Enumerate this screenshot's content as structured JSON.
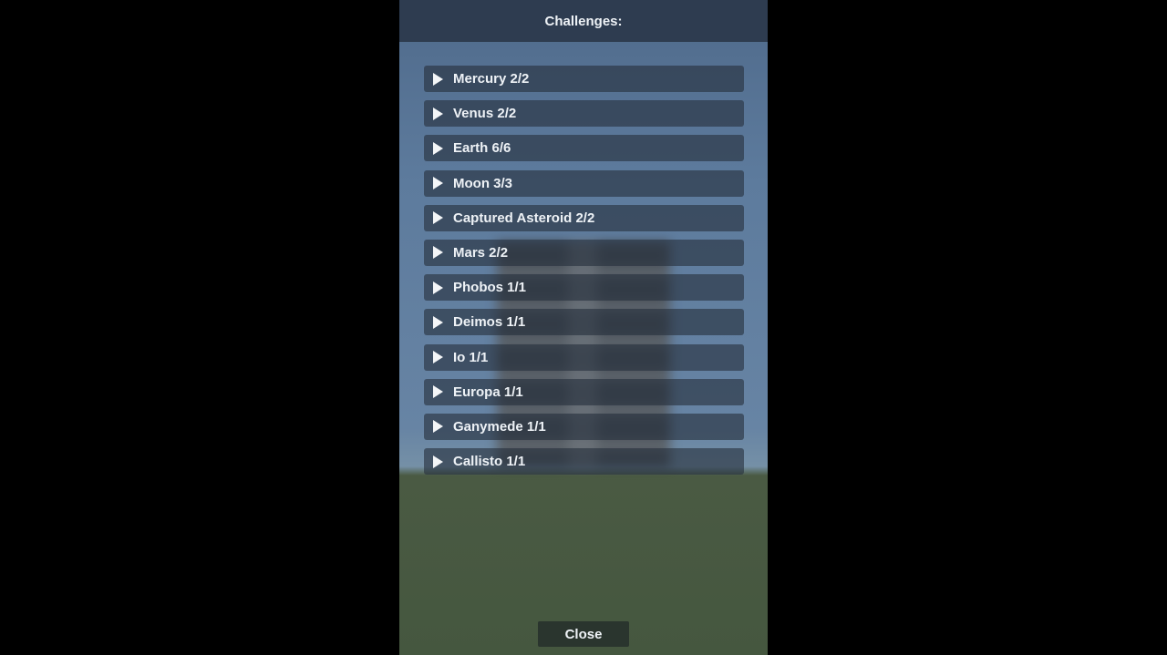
{
  "header": {
    "title": "Challenges:"
  },
  "challenges": [
    {
      "label": "Mercury 2/2"
    },
    {
      "label": "Venus 2/2"
    },
    {
      "label": "Earth 6/6"
    },
    {
      "label": "Moon 3/3"
    },
    {
      "label": "Captured Asteroid 2/2"
    },
    {
      "label": "Mars 2/2"
    },
    {
      "label": "Phobos 1/1"
    },
    {
      "label": "Deimos 1/1"
    },
    {
      "label": "Io 1/1"
    },
    {
      "label": "Europa 1/1"
    },
    {
      "label": "Ganymede 1/1"
    },
    {
      "label": "Callisto 1/1"
    }
  ],
  "footer": {
    "close_label": "Close"
  }
}
